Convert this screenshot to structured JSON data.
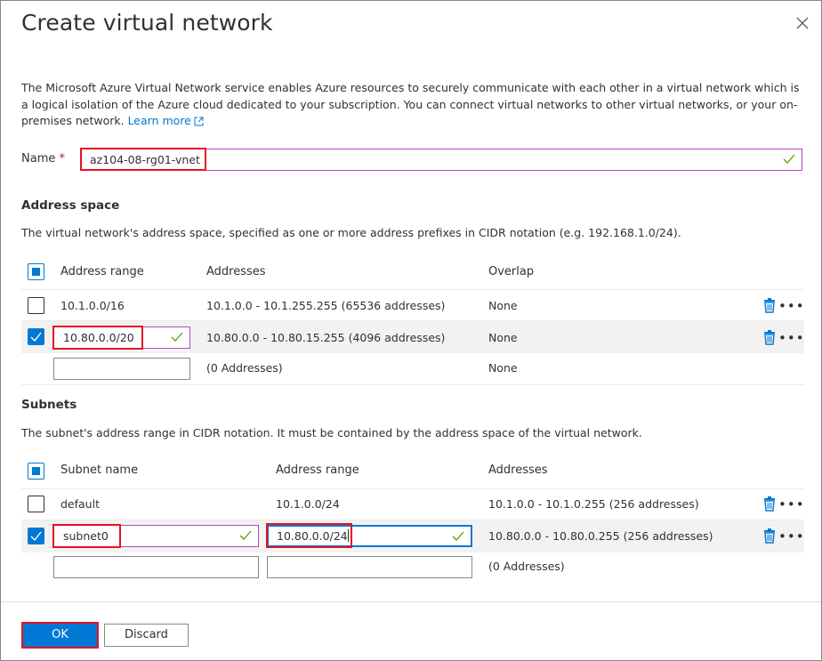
{
  "dialog": {
    "title": "Create virtual network",
    "description": "The Microsoft Azure Virtual Network service enables Azure resources to securely communicate with each other in a virtual network which is a logical isolation of the Azure cloud dedicated to your subscription. You can connect virtual networks to other virtual networks, or your on-premises network.",
    "learn_more": "Learn more"
  },
  "name_field": {
    "label": "Name",
    "required_mark": "*",
    "value": "az104-08-rg01-vnet"
  },
  "address_space": {
    "heading": "Address space",
    "description": "The virtual network's address space, specified as one or more address prefixes in CIDR notation (e.g. 192.168.1.0/24).",
    "columns": [
      "Address range",
      "Addresses",
      "Overlap"
    ],
    "rows": [
      {
        "range": "10.1.0.0/16",
        "addresses": "10.1.0.0 - 10.1.255.255 (65536 addresses)",
        "overlap": "None",
        "checked": false
      },
      {
        "range": "10.80.0.0/20",
        "addresses": "10.80.0.0 - 10.80.15.255 (4096 addresses)",
        "overlap": "None",
        "checked": true
      }
    ],
    "new_row": {
      "range": "",
      "addresses": "(0 Addresses)",
      "overlap": "None"
    }
  },
  "subnets": {
    "heading": "Subnets",
    "description": "The subnet's address range in CIDR notation. It must be contained by the address space of the virtual network.",
    "columns": [
      "Subnet name",
      "Address range",
      "Addresses"
    ],
    "rows": [
      {
        "name": "default",
        "range": "10.1.0.0/24",
        "addresses": "10.1.0.0 - 10.1.0.255 (256 addresses)",
        "checked": false
      },
      {
        "name": "subnet0",
        "range": "10.80.0.0/24",
        "addresses": "10.80.0.0 - 10.80.0.255 (256 addresses)",
        "checked": true
      }
    ],
    "new_row": {
      "name": "",
      "range": "",
      "addresses": "(0 Addresses)"
    }
  },
  "footer": {
    "ok_label": "OK",
    "discard_label": "Discard"
  },
  "colors": {
    "accent": "#0078d4",
    "valid_border": "#b146c2",
    "check_green": "#57a300",
    "highlight_red": "#e81123"
  },
  "icons": {
    "close": "close-icon",
    "external_link": "external-link-icon",
    "check": "checkmark-icon",
    "delete": "trash-icon",
    "more": "ellipsis-icon"
  }
}
